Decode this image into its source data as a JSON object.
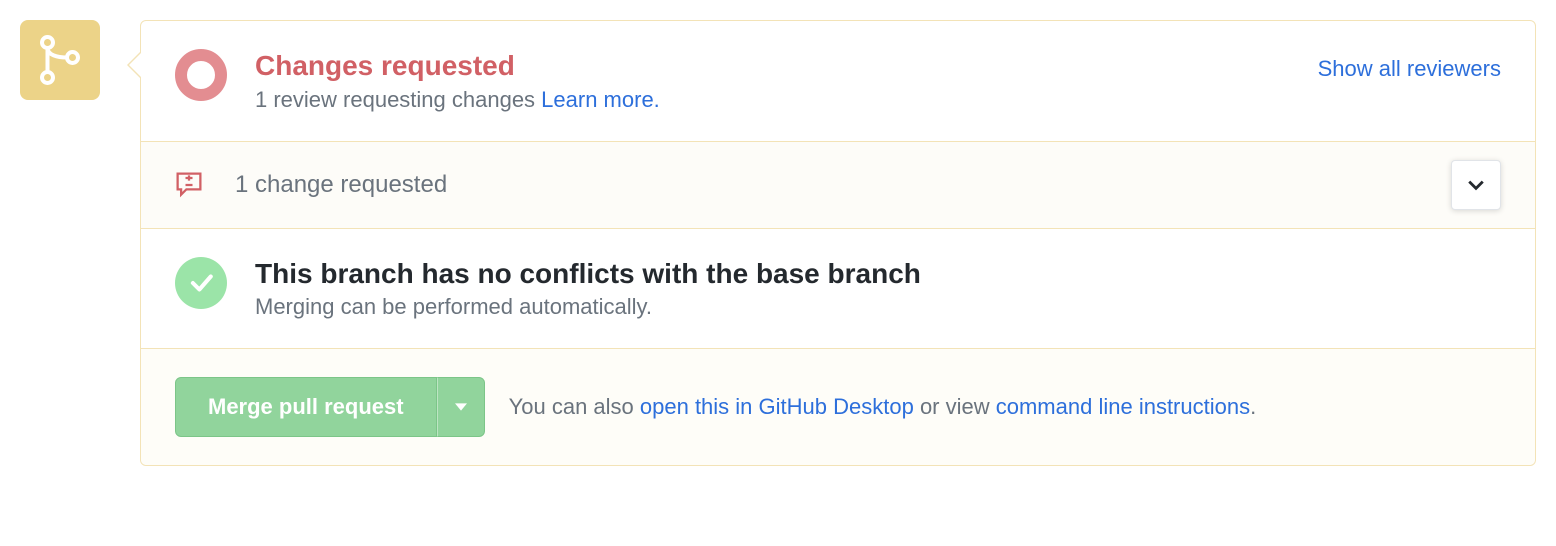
{
  "review": {
    "title": "Changes requested",
    "subtitle_prefix": "1 review requesting changes ",
    "learn_more": "Learn more.",
    "show_all": "Show all reviewers"
  },
  "changes": {
    "count_text": "1 change requested"
  },
  "conflicts": {
    "title": "This branch has no conflicts with the base branch",
    "subtitle": "Merging can be performed automatically."
  },
  "footer": {
    "merge_label": "Merge pull request",
    "text_prefix": "You can also ",
    "open_desktop": "open this in GitHub Desktop",
    "middle": " or view ",
    "cmdline": "command line instructions",
    "suffix": "."
  }
}
